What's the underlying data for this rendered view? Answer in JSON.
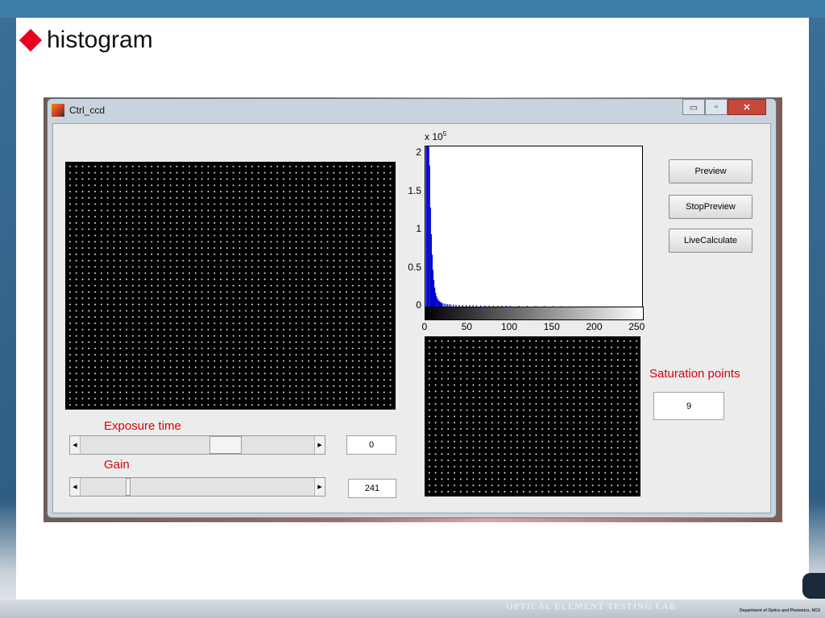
{
  "slide": {
    "title": "histogram"
  },
  "window": {
    "title": "Ctrl_ccd",
    "controls": {
      "minimize": "▭",
      "maximize": "▫",
      "close": "✕"
    }
  },
  "buttons": {
    "preview": "Preview",
    "stop_preview": "StopPreview",
    "live_calculate": "LiveCalculate"
  },
  "exposure": {
    "label": "Exposure time",
    "value": "0",
    "slider_fraction": 0.64
  },
  "gain": {
    "label": "Gain",
    "value": "241",
    "slider_fraction": 0.2
  },
  "saturation": {
    "label": "Saturation points",
    "value": "9"
  },
  "footer": {
    "lab_name": "OPTICAL ELEMENT TESTING LAB",
    "dept": "Department of Optics and Photonics, NCU"
  },
  "chart_data": {
    "type": "bar",
    "title": "",
    "xlabel": "",
    "ylabel": "",
    "y_multiplier": "x 10",
    "y_multiplier_exp": "5",
    "xlim": [
      0,
      255
    ],
    "ylim": [
      0,
      2.1
    ],
    "xticks": [
      "0",
      "50",
      "100",
      "150",
      "200",
      "250"
    ],
    "yticks": [
      "0",
      "0.5",
      "1",
      "1.5",
      "2"
    ],
    "bar_color": "#0000cc",
    "x": [
      1,
      2,
      3,
      4,
      5,
      6,
      7,
      8,
      9,
      10,
      11,
      12,
      13,
      14,
      15,
      16,
      17,
      18,
      19,
      20,
      22,
      24,
      26,
      28,
      30,
      33,
      36,
      40,
      44,
      48,
      52,
      56,
      60,
      65,
      70,
      75,
      80,
      85,
      90,
      95,
      100,
      110,
      120,
      130,
      140,
      150,
      160,
      170,
      180,
      190,
      200,
      210,
      220,
      230,
      240,
      250
    ],
    "values": [
      2.1,
      2.1,
      2.1,
      2.1,
      1.85,
      1.3,
      0.95,
      0.68,
      0.48,
      0.35,
      0.25,
      0.18,
      0.14,
      0.11,
      0.09,
      0.075,
      0.065,
      0.057,
      0.05,
      0.045,
      0.04,
      0.035,
      0.032,
      0.03,
      0.028,
      0.026,
      0.024,
      0.022,
      0.02,
      0.019,
      0.018,
      0.017,
      0.016,
      0.015,
      0.014,
      0.013,
      0.013,
      0.012,
      0.012,
      0.011,
      0.011,
      0.01,
      0.009,
      0.008,
      0.007,
      0.006,
      0.005,
      0.004,
      0.004,
      0.003,
      0.003,
      0.002,
      0.002,
      0.002,
      0.001,
      0.001
    ]
  }
}
